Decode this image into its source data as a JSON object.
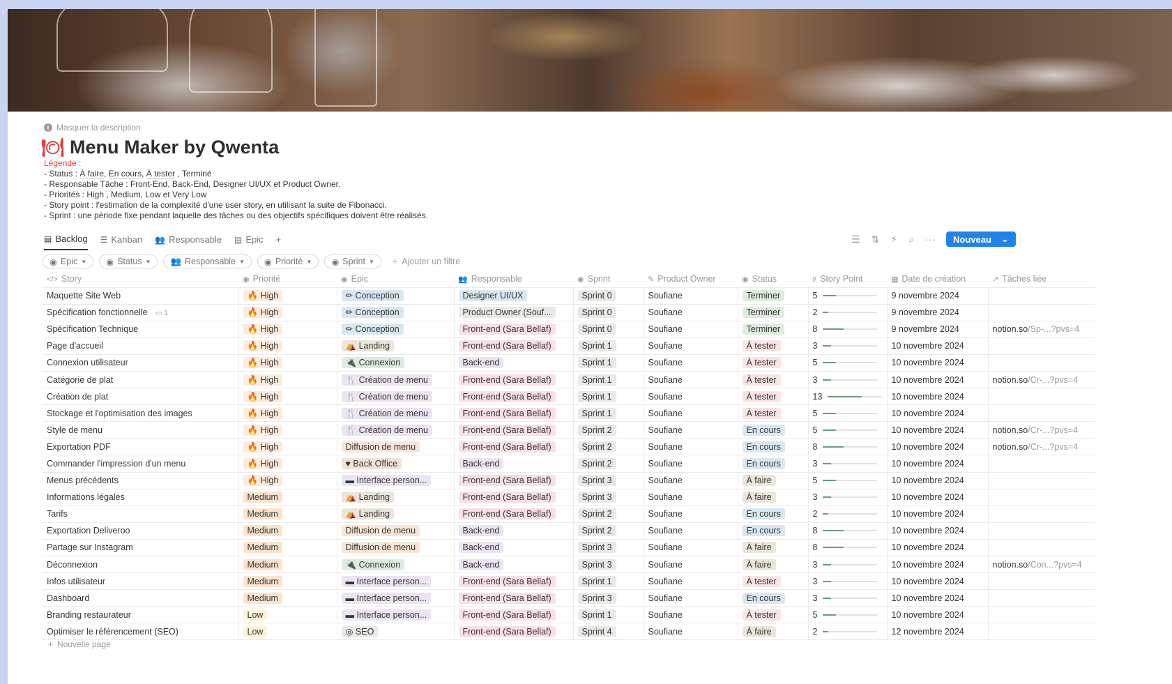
{
  "page": {
    "hide_description": "Masquer la description",
    "title": "Menu Maker by Qwenta",
    "legend": {
      "title": "Légende :",
      "status": {
        "prefix": "- Status : ",
        "items": [
          "À faire",
          "En cours",
          "À tester",
          "Terminé"
        ]
      },
      "lines": [
        "- Responsable Tâche : Front-End, Back-End, Designer UI/UX et Product Owner.",
        "- Priorités : High , Medium, Low et Very Low",
        "- Story point : l'estimation de la complexité d'une user story, en utilisant la suite de Fibonacci.",
        "- Sprint : une période fixe pendant laquelle des tâches ou des objectifs spécifiques doivent être réalisés."
      ]
    },
    "new_page": "Nouvelle page"
  },
  "views": [
    {
      "label": "Backlog",
      "icon": "table-icon",
      "active": true
    },
    {
      "label": "Kanban",
      "icon": "board-icon",
      "active": false
    },
    {
      "label": "Responsable",
      "icon": "people-icon",
      "active": false
    },
    {
      "label": "Epic",
      "icon": "table-icon",
      "active": false
    }
  ],
  "toolbar": {
    "new_label": "Nouveau"
  },
  "filters": [
    "Epic",
    "Status",
    "Responsable",
    "Priorité",
    "Sprint"
  ],
  "add_filter": "Ajouter un filtre",
  "columns": [
    "Story",
    "Priorité",
    "Epic",
    "Responsable",
    "Sprint",
    "Product Owner",
    "Status",
    "Story Point",
    "Date de création",
    "Tâches liée"
  ],
  "colors": {
    "accent": "#2383e2",
    "high": "#fbecdd",
    "medium": "#fbe4cf",
    "low": "#fdf4d6",
    "epic_conception": "#d8e8f3",
    "epic_landing": "#ebe6dc",
    "epic_connexion": "#ddeddf",
    "epic_creation": "#ebe4f3",
    "epic_diffusion": "#f7e6d9",
    "epic_backoffice": "#f3e2d7",
    "epic_interface": "#ebe4f3",
    "epic_seo": "#e9e9e7",
    "resp_design": "#d8e8f3",
    "resp_po": "#e9e9e7",
    "resp_front": "#f8dfe8",
    "resp_back": "#ebe4f3",
    "sprint": "#e9e9e7",
    "status_done": "#ddeddf",
    "status_test": "#fbe4e4",
    "status_progress": "#d8e8f3",
    "status_todo": "#ebe6dc"
  },
  "rows": [
    {
      "story": "Maquette Site Web",
      "priority": "High",
      "epic": "Conception",
      "resp": "Designer UI/UX",
      "sprint": "Sprint 0",
      "po": "Soufiane",
      "status": "Terminer",
      "sp": 5,
      "date": "9 novembre 2024",
      "link": "",
      "link_dim": ""
    },
    {
      "story": "Spécification fonctionnelle",
      "comments": "1",
      "priority": "High",
      "epic": "Conception",
      "resp": "Product Owner (Souf...",
      "sprint": "Sprint 0",
      "po": "Soufiane",
      "status": "Terminer",
      "sp": 2,
      "date": "9 novembre 2024",
      "link": "",
      "link_dim": ""
    },
    {
      "story": "Spécification Technique",
      "priority": "High",
      "epic": "Conception",
      "resp": "Front-end (Sara Bellaf)",
      "sprint": "Sprint 0",
      "po": "Soufiane",
      "status": "Terminer",
      "sp": 8,
      "date": "9 novembre 2024",
      "link": "notion.so",
      "link_dim": "/Sp-...?pvs=4"
    },
    {
      "story": "Page d'accueil",
      "priority": "High",
      "epic": "Landing",
      "resp": "Front-end (Sara Bellaf)",
      "sprint": "Sprint 1",
      "po": "Soufiane",
      "status": "À tester",
      "sp": 3,
      "date": "10 novembre 2024",
      "link": "",
      "link_dim": ""
    },
    {
      "story": "Connexion utilisateur",
      "priority": "High",
      "epic": "Connexion",
      "resp": "Back-end",
      "sprint": "Sprint 1",
      "po": "Soufiane",
      "status": "À tester",
      "sp": 5,
      "date": "10 novembre 2024",
      "link": "",
      "link_dim": ""
    },
    {
      "story": "Catégorie de plat",
      "priority": "High",
      "epic": "Création de menu",
      "resp": "Front-end (Sara Bellaf)",
      "sprint": "Sprint 1",
      "po": "Soufiane",
      "status": "À tester",
      "sp": 3,
      "date": "10 novembre 2024",
      "link": "notion.so",
      "link_dim": "/Cr-...?pvs=4"
    },
    {
      "story": "Création de plat",
      "priority": "High",
      "epic": "Création de menu",
      "resp": "Front-end (Sara Bellaf)",
      "sprint": "Sprint 1",
      "po": "Soufiane",
      "status": "À tester",
      "sp": 13,
      "date": "10 novembre 2024",
      "link": "",
      "link_dim": ""
    },
    {
      "story": "Stockage et l'optimisation des images",
      "priority": "High",
      "epic": "Création de menu",
      "resp": "Front-end (Sara Bellaf)",
      "sprint": "Sprint 1",
      "po": "Soufiane",
      "status": "À tester",
      "sp": 5,
      "date": "10 novembre 2024",
      "link": "",
      "link_dim": ""
    },
    {
      "story": "Style de menu",
      "priority": "High",
      "epic": "Création de menu",
      "resp": "Front-end (Sara Bellaf)",
      "sprint": "Sprint 2",
      "po": "Soufiane",
      "status": "En cours",
      "sp": 5,
      "date": "10 novembre 2024",
      "link": "notion.so",
      "link_dim": "/Cr-...?pvs=4"
    },
    {
      "story": "Exportation PDF",
      "priority": "High",
      "epic": "Diffusion de menu",
      "resp": "Front-end (Sara Bellaf)",
      "sprint": "Sprint 2",
      "po": "Soufiane",
      "status": "En cours",
      "sp": 8,
      "date": "10 novembre 2024",
      "link": "notion.so",
      "link_dim": "/Cr-...?pvs=4"
    },
    {
      "story": "Commander l'impression d'un menu",
      "priority": "High",
      "epic": "Back Office",
      "resp": "Back-end",
      "sprint": "Sprint 2",
      "po": "Soufiane",
      "status": "En cours",
      "sp": 3,
      "date": "10 novembre 2024",
      "link": "",
      "link_dim": ""
    },
    {
      "story": "Menus précédents",
      "priority": "High",
      "epic": "Interface person...",
      "resp": "Front-end (Sara Bellaf)",
      "sprint": "Sprint 3",
      "po": "Soufiane",
      "status": "À faire",
      "sp": 5,
      "date": "10 novembre 2024",
      "link": "",
      "link_dim": ""
    },
    {
      "story": "Informations légales",
      "priority": "Medium",
      "epic": "Landing",
      "resp": "Front-end (Sara Bellaf)",
      "sprint": "Sprint 3",
      "po": "Soufiane",
      "status": "À faire",
      "sp": 3,
      "date": "10 novembre 2024",
      "link": "",
      "link_dim": ""
    },
    {
      "story": "Tarifs",
      "priority": "Medium",
      "epic": "Landing",
      "resp": "Front-end (Sara Bellaf)",
      "sprint": "Sprint 2",
      "po": "Soufiane",
      "status": "En cours",
      "sp": 2,
      "date": "10 novembre 2024",
      "link": "",
      "link_dim": ""
    },
    {
      "story": "Exportation Deliveroo",
      "priority": "Medium",
      "epic": "Diffusion de menu",
      "resp": "Back-end",
      "sprint": "Sprint 2",
      "po": "Soufiane",
      "status": "En cours",
      "sp": 8,
      "date": "10 novembre 2024",
      "link": "",
      "link_dim": ""
    },
    {
      "story": "Partage sur Instagram",
      "priority": "Medium",
      "epic": "Diffusion de menu",
      "resp": "Back-end",
      "sprint": "Sprint 3",
      "po": "Soufiane",
      "status": "À faire",
      "sp": 8,
      "date": "10 novembre 2024",
      "link": "",
      "link_dim": ""
    },
    {
      "story": "Déconnexion",
      "priority": "Medium",
      "epic": "Connexion",
      "resp": "Back-end",
      "sprint": "Sprint 3",
      "po": "Soufiane",
      "status": "À faire",
      "sp": 3,
      "date": "10 novembre 2024",
      "link": "notion.so",
      "link_dim": "/Con...?pvs=4"
    },
    {
      "story": "Infos utilisateur",
      "priority": "Medium",
      "epic": "Interface person...",
      "resp": "Front-end (Sara Bellaf)",
      "sprint": "Sprint 1",
      "po": "Soufiane",
      "status": "À tester",
      "sp": 3,
      "date": "10 novembre 2024",
      "link": "",
      "link_dim": ""
    },
    {
      "story": "Dashboard",
      "priority": "Medium",
      "epic": "Interface person...",
      "resp": "Front-end (Sara Bellaf)",
      "sprint": "Sprint 3",
      "po": "Soufiane",
      "status": "En cours",
      "sp": 3,
      "date": "10 novembre 2024",
      "link": "",
      "link_dim": ""
    },
    {
      "story": "Branding restaurateur",
      "priority": "Low",
      "epic": "Interface person...",
      "resp": "Front-end (Sara Bellaf)",
      "sprint": "Sprint 1",
      "po": "Soufiane",
      "status": "À tester",
      "sp": 5,
      "date": "10 novembre 2024",
      "link": "",
      "link_dim": ""
    },
    {
      "story": "Optimiser le référencement (SEO)",
      "priority": "Low",
      "epic": "SEO",
      "resp": "Front-end (Sara Bellaf)",
      "sprint": "Sprint 4",
      "po": "Soufiane",
      "status": "À faire",
      "sp": 2,
      "date": "12 novembre 2024",
      "link": "",
      "link_dim": ""
    }
  ]
}
